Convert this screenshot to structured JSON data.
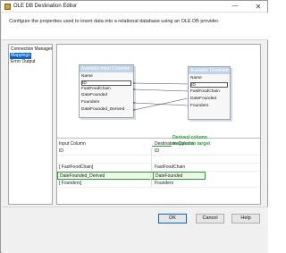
{
  "window": {
    "title": "OLE DB Destination Editor",
    "min_glyph": "—",
    "close_glyph": "✕"
  },
  "header": {
    "description": "Configure the properties used to insert data into a relational database using an OLE DB provider."
  },
  "nav": {
    "items": [
      {
        "label": "Connection Manager",
        "selected": false
      },
      {
        "label": "Mappings",
        "selected": true
      },
      {
        "label": "Error Output",
        "selected": false
      }
    ]
  },
  "mapping": {
    "input_box": {
      "title": "Available Input Columns",
      "rows": [
        "Name",
        "ID",
        "FastFoodChain",
        "DateFounded",
        "Founders",
        "DateFounded_Derived"
      ]
    },
    "dest_box": {
      "title": "Available Destinatio...",
      "rows": [
        "Name",
        "ID",
        "FastFoodChain",
        "DateFounded",
        "Founders"
      ]
    }
  },
  "grid": {
    "headers": {
      "input": "Input Column",
      "destination": "Destination Column"
    },
    "rows": [
      {
        "input": "ID",
        "destination": "ID"
      },
      {
        "input": "",
        "destination": ""
      },
      {
        "input": "[ FastFoodChain]",
        "destination": "FastFoodChain"
      },
      {
        "input": "DateFounded_Derived",
        "destination": "DateFounded"
      },
      {
        "input": "[ Founders]",
        "destination": "Founders"
      }
    ],
    "callout": "Derived column mapped to target",
    "highlight_color": "#2f9b3a"
  },
  "footer": {
    "ok": "OK",
    "cancel": "Cancel",
    "help": "Help"
  },
  "colors": {
    "selection": "#0a64c8",
    "box_title": "#c2d3e8",
    "accent_green": "#2f9b3a"
  }
}
